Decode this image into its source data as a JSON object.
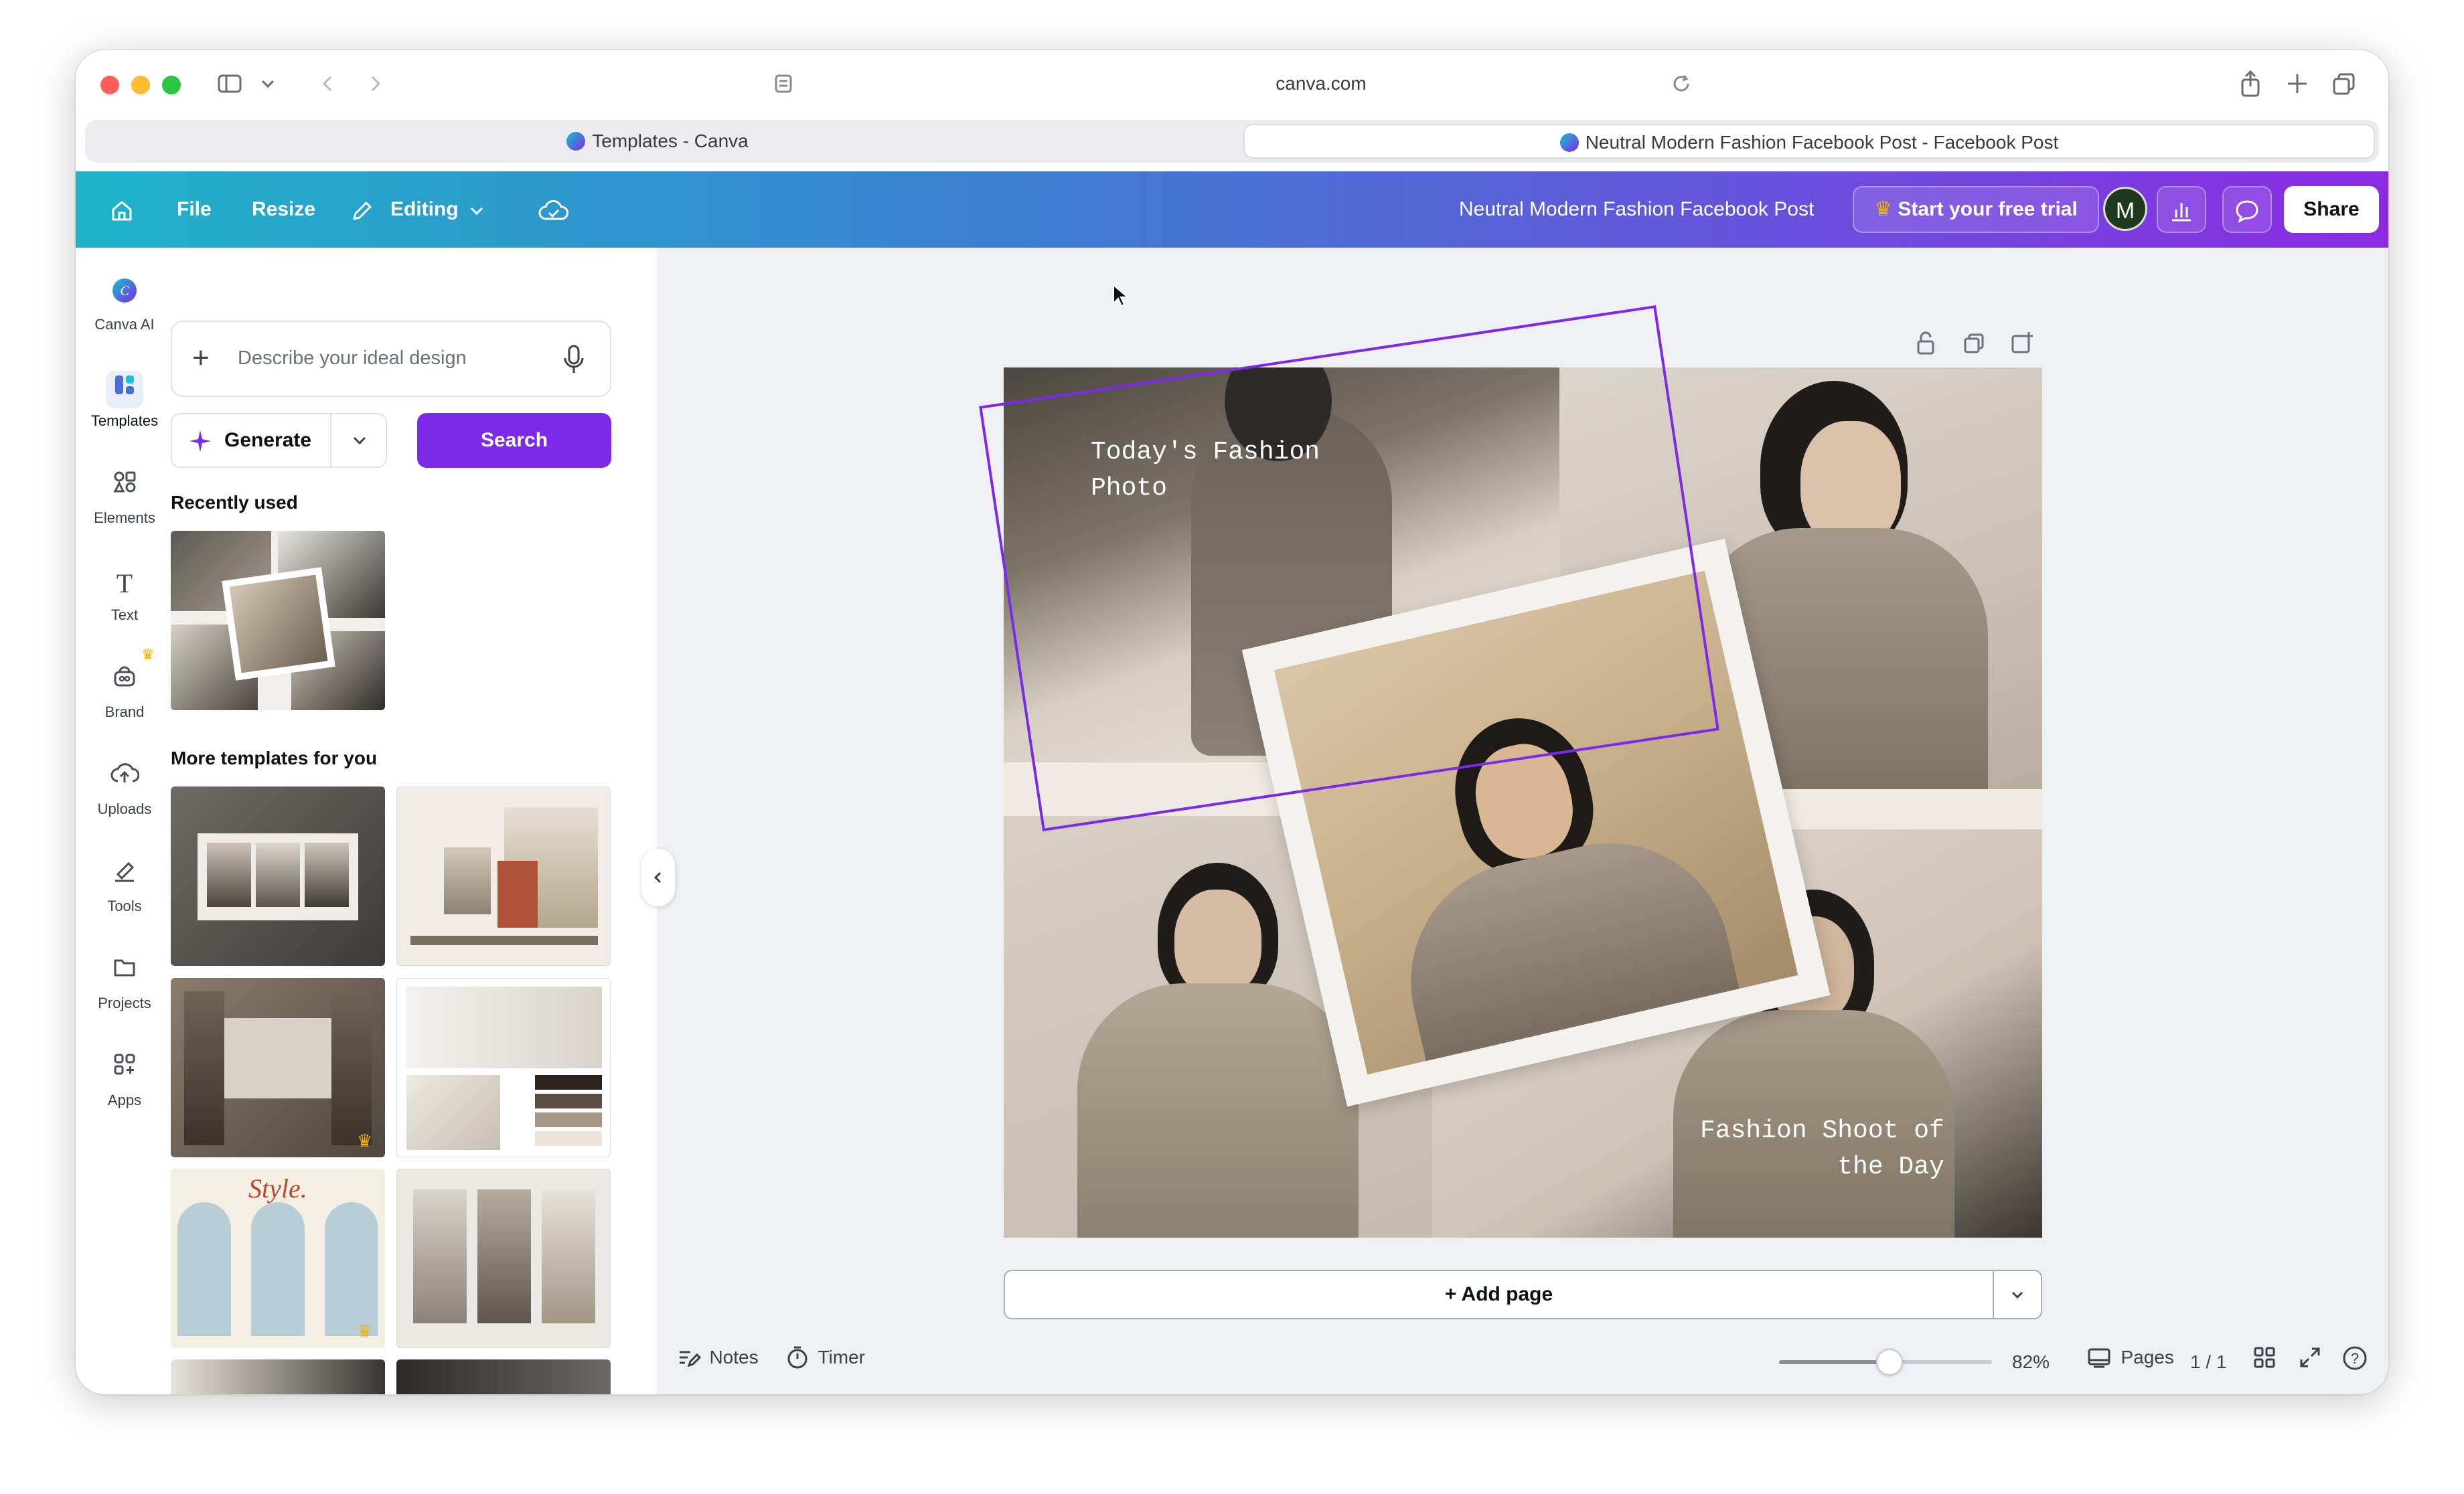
{
  "browser": {
    "url": "canva.com",
    "tabs": [
      {
        "label": "Templates - Canva",
        "active": false
      },
      {
        "label": "Neutral Modern Fashion Facebook Post - Facebook Post",
        "active": true
      }
    ]
  },
  "header": {
    "file": "File",
    "resize": "Resize",
    "editing": "Editing",
    "design_title": "Neutral Modern Fashion Facebook Post",
    "trial": "Start your free trial",
    "avatar_initial": "M",
    "share": "Share"
  },
  "rail": {
    "items": [
      {
        "label": "Canva AI",
        "icon": "canva-ai-icon"
      },
      {
        "label": "Templates",
        "icon": "templates-icon"
      },
      {
        "label": "Elements",
        "icon": "elements-icon"
      },
      {
        "label": "Text",
        "icon": "text-icon"
      },
      {
        "label": "Brand",
        "icon": "brand-icon"
      },
      {
        "label": "Uploads",
        "icon": "uploads-icon"
      },
      {
        "label": "Tools",
        "icon": "tools-icon"
      },
      {
        "label": "Projects",
        "icon": "projects-icon"
      },
      {
        "label": "Apps",
        "icon": "apps-icon"
      }
    ]
  },
  "panel": {
    "prompt_placeholder": "Describe your ideal design",
    "generate": "Generate",
    "search": "Search",
    "recently_used": "Recently used",
    "more_templates": "More templates for you"
  },
  "canvas": {
    "text_top": "Today's Fashion\nPhoto",
    "text_bottom": "Fashion Shoot of\n     the Day",
    "add_page": "+ Add page"
  },
  "footer": {
    "notes": "Notes",
    "timer": "Timer",
    "zoom": "82%",
    "zoom_level": 0.52,
    "pages": "Pages",
    "page_count": "1 / 1"
  },
  "colors": {
    "accent": "#7d2ae8",
    "header_start": "#1fb3c9",
    "header_end": "#8a2be2",
    "selection": "#7d2ae8"
  }
}
